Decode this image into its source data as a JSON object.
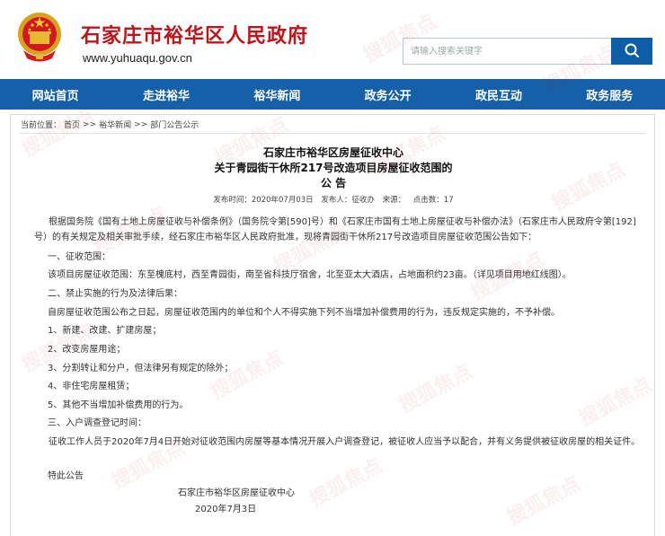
{
  "header": {
    "site_title": "石家庄市裕华区人民政府",
    "site_url": "www.yuhuaqu.gov.cn",
    "search_placeholder": "请输入搜索关键字"
  },
  "nav": {
    "items": [
      "网站首页",
      "走进裕华",
      "裕华新闻",
      "政务公开",
      "政民互动",
      "政务服务"
    ]
  },
  "breadcrumb": {
    "prefix": "当前位置：",
    "items": [
      "首页",
      "裕华新闻",
      "部门公告公示"
    ],
    "separator": ">>"
  },
  "article": {
    "title_line1": "石家庄市裕华区房屋征收中心",
    "title_line2": "关于青园街干休所217号改造项目房屋征收范围的",
    "title_line3": "公 告",
    "meta_date": "发布时间：2020年07月03日",
    "meta_author": "发布人：征收办",
    "meta_source": "来源：",
    "meta_clicks": "点击数：17",
    "paragraphs": [
      "根据国务院《国有土地上房屋征收与补偿条例》（国务院令第[590]号）和《石家庄市国有土地上房屋征收与补偿办法》（石家庄市人民政府令第[192]号）的有关规定及相关审批手续，经石家庄市裕华区人民政府批准，现将青园街干休所217号改造项目房屋征收范围公告如下：",
      "一、征收范围：",
      "该项目房屋征收范围：东至槐底村，西至青园街，南至省科技厅宿舍，北至亚太大酒店，占地面积约23亩。（详见项目用地红线图）。",
      "二、禁止实施的行为及法律后果：",
      "自房屋征收范围公布之日起，房屋征收范围内的单位和个人不得实施下列不当增加补偿费用的行为，违反规定实施的，不予补偿。",
      "1、新建、改建、扩建房屋；",
      "2、改变房屋用途；",
      "3、分割转让和分户，但法律另有规定的除外；",
      "4、非住宅房屋租赁；",
      "5、其他不当增加补偿费用的行为。",
      "三、入户调查登记时间：",
      "征收工作人员于2020年7月4日开始对征收范围内房屋等基本情况开展入户调查登记，被征收人应当予以配合，并有义务提供被征收房屋的相关证件。",
      "特此公告"
    ],
    "signature_org": "石家庄市裕华区房屋征收中心",
    "signature_date": "2020年7月3日"
  },
  "watermark": {
    "text": "搜狐焦点"
  },
  "colors": {
    "title_red": "#c0141a",
    "nav_blue": "#1560a9",
    "search_button_blue": "#0d5ea8"
  },
  "icons": {
    "emblem": "national-emblem-icon",
    "search": "search-icon"
  }
}
